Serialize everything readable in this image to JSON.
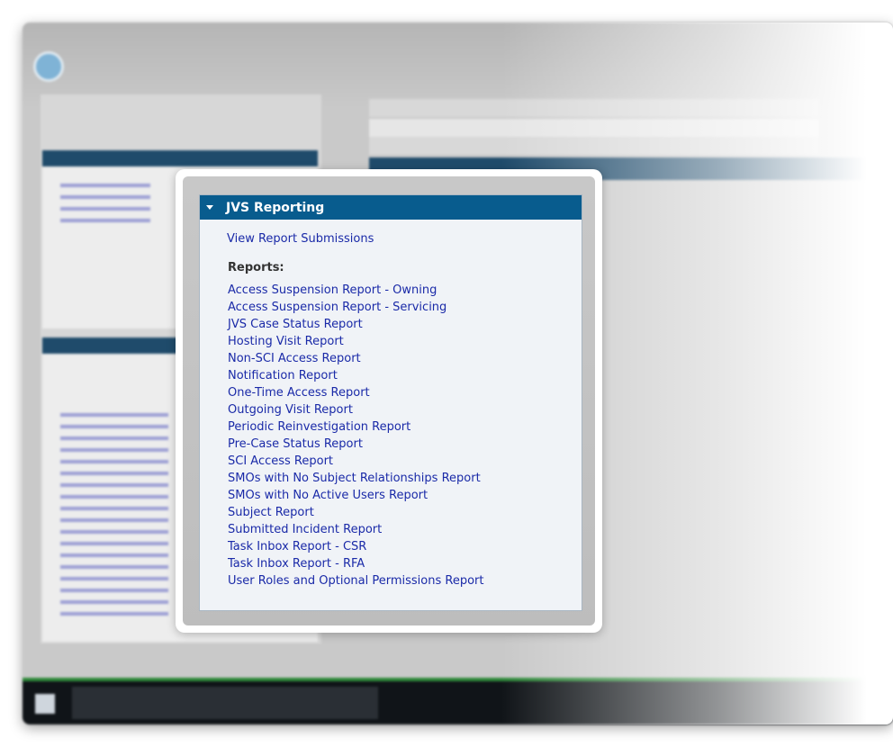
{
  "panel": {
    "title": "JVS Reporting",
    "view_link": "View Report Submissions",
    "reports_label": "Reports:",
    "reports": [
      "Access Suspension Report - Owning",
      "Access Suspension Report - Servicing",
      "JVS Case Status Report",
      "Hosting Visit Report",
      "Non-SCI Access Report",
      "Notification Report",
      "One-Time Access Report",
      "Outgoing Visit Report",
      "Periodic Reinvestigation Report",
      "Pre-Case Status Report",
      "SCI Access Report",
      "SMOs with No Subject Relationships Report",
      "SMOs with No Active Users Report",
      "Subject Report",
      "Submitted Incident Report",
      "Task Inbox Report - CSR",
      "Task Inbox Report - RFA",
      "User Roles and Optional Permissions Report"
    ]
  },
  "colors": {
    "header_bg": "#085c8e",
    "link": "#1a2aa8",
    "panel_bg": "#f0f3f7"
  },
  "icons": {
    "collapse": "caret-down-icon"
  }
}
